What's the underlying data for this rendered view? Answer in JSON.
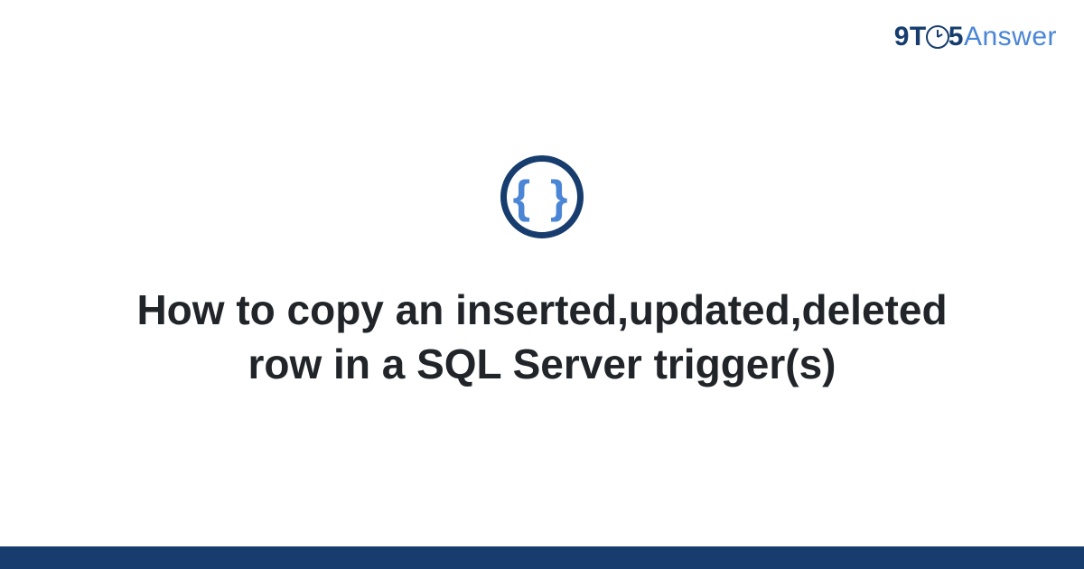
{
  "logo": {
    "prefix": "9T",
    "suffix": "5",
    "answer": "Answer"
  },
  "icon": {
    "braces": "{ }"
  },
  "title": "How to copy an inserted,updated,deleted row in a SQL Server trigger(s)"
}
